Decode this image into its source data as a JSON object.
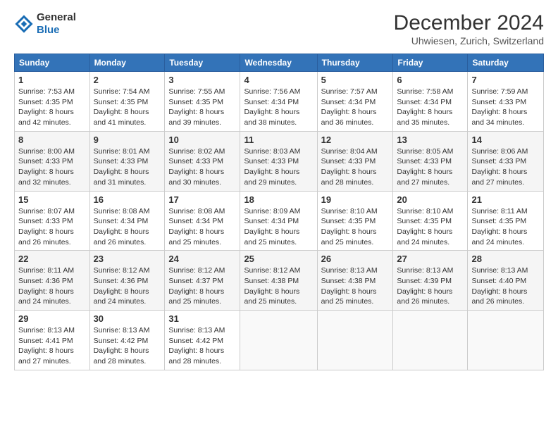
{
  "logo": {
    "general": "General",
    "blue": "Blue"
  },
  "title": "December 2024",
  "subtitle": "Uhwiesen, Zurich, Switzerland",
  "days_of_week": [
    "Sunday",
    "Monday",
    "Tuesday",
    "Wednesday",
    "Thursday",
    "Friday",
    "Saturday"
  ],
  "weeks": [
    [
      {
        "day": "1",
        "info": "Sunrise: 7:53 AM\nSunset: 4:35 PM\nDaylight: 8 hours\nand 42 minutes."
      },
      {
        "day": "2",
        "info": "Sunrise: 7:54 AM\nSunset: 4:35 PM\nDaylight: 8 hours\nand 41 minutes."
      },
      {
        "day": "3",
        "info": "Sunrise: 7:55 AM\nSunset: 4:35 PM\nDaylight: 8 hours\nand 39 minutes."
      },
      {
        "day": "4",
        "info": "Sunrise: 7:56 AM\nSunset: 4:34 PM\nDaylight: 8 hours\nand 38 minutes."
      },
      {
        "day": "5",
        "info": "Sunrise: 7:57 AM\nSunset: 4:34 PM\nDaylight: 8 hours\nand 36 minutes."
      },
      {
        "day": "6",
        "info": "Sunrise: 7:58 AM\nSunset: 4:34 PM\nDaylight: 8 hours\nand 35 minutes."
      },
      {
        "day": "7",
        "info": "Sunrise: 7:59 AM\nSunset: 4:33 PM\nDaylight: 8 hours\nand 34 minutes."
      }
    ],
    [
      {
        "day": "8",
        "info": "Sunrise: 8:00 AM\nSunset: 4:33 PM\nDaylight: 8 hours\nand 32 minutes."
      },
      {
        "day": "9",
        "info": "Sunrise: 8:01 AM\nSunset: 4:33 PM\nDaylight: 8 hours\nand 31 minutes."
      },
      {
        "day": "10",
        "info": "Sunrise: 8:02 AM\nSunset: 4:33 PM\nDaylight: 8 hours\nand 30 minutes."
      },
      {
        "day": "11",
        "info": "Sunrise: 8:03 AM\nSunset: 4:33 PM\nDaylight: 8 hours\nand 29 minutes."
      },
      {
        "day": "12",
        "info": "Sunrise: 8:04 AM\nSunset: 4:33 PM\nDaylight: 8 hours\nand 28 minutes."
      },
      {
        "day": "13",
        "info": "Sunrise: 8:05 AM\nSunset: 4:33 PM\nDaylight: 8 hours\nand 27 minutes."
      },
      {
        "day": "14",
        "info": "Sunrise: 8:06 AM\nSunset: 4:33 PM\nDaylight: 8 hours\nand 27 minutes."
      }
    ],
    [
      {
        "day": "15",
        "info": "Sunrise: 8:07 AM\nSunset: 4:33 PM\nDaylight: 8 hours\nand 26 minutes."
      },
      {
        "day": "16",
        "info": "Sunrise: 8:08 AM\nSunset: 4:34 PM\nDaylight: 8 hours\nand 26 minutes."
      },
      {
        "day": "17",
        "info": "Sunrise: 8:08 AM\nSunset: 4:34 PM\nDaylight: 8 hours\nand 25 minutes."
      },
      {
        "day": "18",
        "info": "Sunrise: 8:09 AM\nSunset: 4:34 PM\nDaylight: 8 hours\nand 25 minutes."
      },
      {
        "day": "19",
        "info": "Sunrise: 8:10 AM\nSunset: 4:35 PM\nDaylight: 8 hours\nand 25 minutes."
      },
      {
        "day": "20",
        "info": "Sunrise: 8:10 AM\nSunset: 4:35 PM\nDaylight: 8 hours\nand 24 minutes."
      },
      {
        "day": "21",
        "info": "Sunrise: 8:11 AM\nSunset: 4:35 PM\nDaylight: 8 hours\nand 24 minutes."
      }
    ],
    [
      {
        "day": "22",
        "info": "Sunrise: 8:11 AM\nSunset: 4:36 PM\nDaylight: 8 hours\nand 24 minutes."
      },
      {
        "day": "23",
        "info": "Sunrise: 8:12 AM\nSunset: 4:36 PM\nDaylight: 8 hours\nand 24 minutes."
      },
      {
        "day": "24",
        "info": "Sunrise: 8:12 AM\nSunset: 4:37 PM\nDaylight: 8 hours\nand 25 minutes."
      },
      {
        "day": "25",
        "info": "Sunrise: 8:12 AM\nSunset: 4:38 PM\nDaylight: 8 hours\nand 25 minutes."
      },
      {
        "day": "26",
        "info": "Sunrise: 8:13 AM\nSunset: 4:38 PM\nDaylight: 8 hours\nand 25 minutes."
      },
      {
        "day": "27",
        "info": "Sunrise: 8:13 AM\nSunset: 4:39 PM\nDaylight: 8 hours\nand 26 minutes."
      },
      {
        "day": "28",
        "info": "Sunrise: 8:13 AM\nSunset: 4:40 PM\nDaylight: 8 hours\nand 26 minutes."
      }
    ],
    [
      {
        "day": "29",
        "info": "Sunrise: 8:13 AM\nSunset: 4:41 PM\nDaylight: 8 hours\nand 27 minutes."
      },
      {
        "day": "30",
        "info": "Sunrise: 8:13 AM\nSunset: 4:42 PM\nDaylight: 8 hours\nand 28 minutes."
      },
      {
        "day": "31",
        "info": "Sunrise: 8:13 AM\nSunset: 4:42 PM\nDaylight: 8 hours\nand 28 minutes."
      },
      null,
      null,
      null,
      null
    ]
  ]
}
